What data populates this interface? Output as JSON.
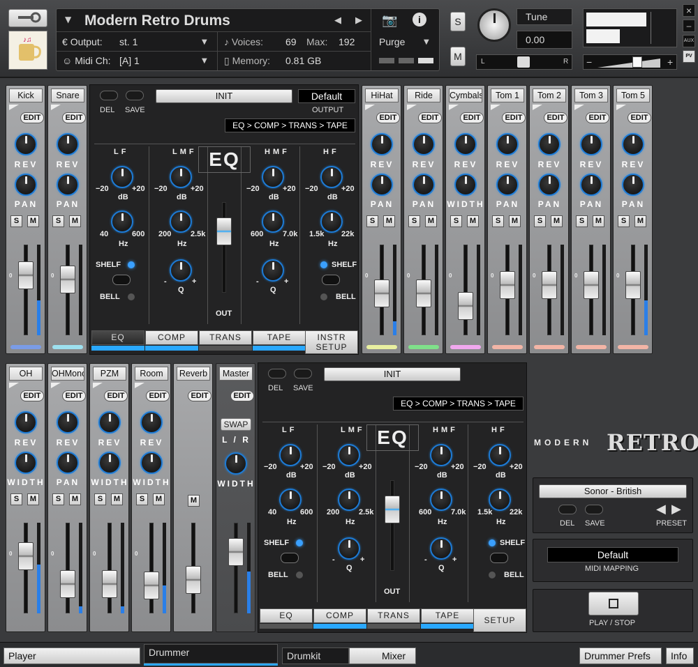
{
  "header": {
    "instrument_title": "Modern Retro Drums",
    "output_label": "Output:",
    "output_value": "st. 1",
    "voices_label": "Voices:",
    "voices_value": "69",
    "max_label": "Max:",
    "max_value": "192",
    "midi_label": "Midi Ch:",
    "midi_value": "[A]  1",
    "memory_label": "Memory:",
    "memory_value": "0.81 GB",
    "purge_label": "Purge",
    "s_label": "S",
    "m_label": "M",
    "tune_label": "Tune",
    "tune_value": "0.00",
    "pan_l": "L",
    "pan_r": "R",
    "aux_label": "AUX",
    "pv_label": "PV",
    "close_glyph": "×",
    "min_glyph": "–",
    "vol_minus": "−",
    "vol_plus": "+"
  },
  "strips_top_left": [
    {
      "name": "Kick",
      "knob2": "PAN",
      "color": "#7a9ce6",
      "fader": 0.7
    },
    {
      "name": "Snare",
      "knob2": "PAN",
      "color": "#9de0ef",
      "fader": 0.68
    }
  ],
  "strips_top_right": [
    {
      "name": "HiHat",
      "knob2": "PAN",
      "color": "#e8efa0"
    },
    {
      "name": "Ride",
      "knob2": "PAN",
      "color": "#7fe08a"
    },
    {
      "name": "Cymbals",
      "knob2": "WIDTH",
      "color": "#f0a8ee"
    },
    {
      "name": "Tom 1",
      "knob2": "PAN",
      "color": "#f2b5a6"
    },
    {
      "name": "Tom 2",
      "knob2": "PAN",
      "color": "#f2b5a6"
    },
    {
      "name": "Tom 3",
      "knob2": "PAN",
      "color": "#f2b5a6"
    },
    {
      "name": "Tom 5",
      "knob2": "PAN",
      "color": "#f2b5a6"
    }
  ],
  "strips_bottom": [
    {
      "name": "OH",
      "knob2": "WIDTH"
    },
    {
      "name": "OHMono",
      "knob2": "PAN"
    },
    {
      "name": "PZM",
      "knob2": "WIDTH"
    },
    {
      "name": "Room",
      "knob2": "WIDTH"
    }
  ],
  "common": {
    "edit": "EDIT",
    "rev": "REV",
    "s": "S",
    "m": "M",
    "zero": "0"
  },
  "reverb_strip": {
    "name": "Reverb"
  },
  "master_strip": {
    "name": "Master",
    "swap": "SWAP",
    "lr": "L / R",
    "width": "WIDTH"
  },
  "eq_top": {
    "del": "DEL",
    "save": "SAVE",
    "preset": "INIT",
    "output_preset": "Default",
    "output_label": "OUTPUT",
    "chain": "EQ > COMP > TRANS > TAPE",
    "title": "EQ",
    "tabs": [
      "EQ",
      "COMP",
      "TRANS",
      "TAPE"
    ],
    "instr_setup": "INSTR SETUP"
  },
  "eq_bottom": {
    "del": "DEL",
    "save": "SAVE",
    "preset": "INIT",
    "chain": "EQ > COMP > TRANS > TAPE",
    "title": "EQ",
    "tabs": [
      "EQ",
      "COMP",
      "TRANS",
      "TAPE"
    ],
    "setup": "SETUP"
  },
  "eq_labels": {
    "lf": "LF",
    "lmf": "LMF",
    "hmf": "HMF",
    "hf": "HF",
    "minus20": "−20",
    "plus20": "+20",
    "db": "dB",
    "hz": "Hz",
    "q": "Q",
    "minus": "-",
    "plus": "+",
    "shelf": "SHELF",
    "bell": "BELL",
    "out": "OUT",
    "lf_min": "40",
    "lf_max": "600",
    "lmf_min": "200",
    "lmf_max": "2.5k",
    "hmf_min": "600",
    "hmf_max": "7.0k",
    "hf_min": "1.5k",
    "hf_max": "22k"
  },
  "logo": {
    "modern": "MODERN",
    "retro": "RETRO"
  },
  "kit_panel": {
    "kit_name": "Sonor - British",
    "del": "DEL",
    "save": "SAVE",
    "preset": "PRESET"
  },
  "midi_panel": {
    "value": "Default",
    "label": "MIDI MAPPING"
  },
  "play_panel": {
    "label": "PLAY / STOP"
  },
  "footer": {
    "player": "Player",
    "drummer": "Drummer",
    "drumkit": "Drumkit",
    "mixer": "Mixer",
    "drummer_prefs": "Drummer Prefs",
    "info": "Info"
  },
  "colors": {
    "accent_blue": "#2aa8ff",
    "led_blue": "#3aa0ff"
  }
}
